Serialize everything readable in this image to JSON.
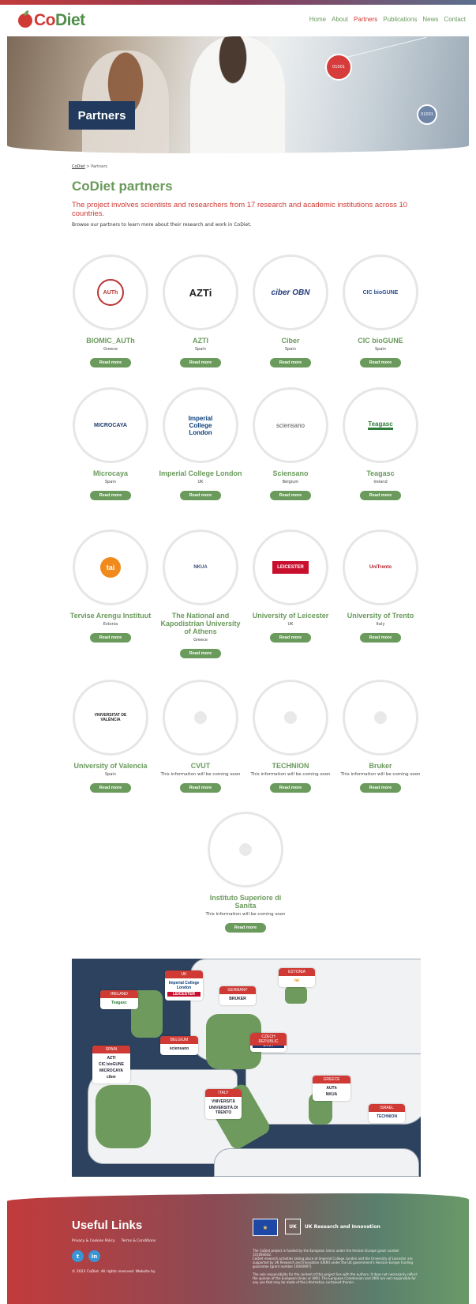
{
  "brand": {
    "name_part1": "Co",
    "name_part2": "Diet"
  },
  "nav": {
    "items": [
      "Home",
      "About",
      "Partners",
      "Publications",
      "News",
      "Contact"
    ],
    "active": "Partners"
  },
  "hero": {
    "label": "Partners",
    "badge1": "01001",
    "badge2": "01001"
  },
  "breadcrumb": {
    "home": "CoDiet",
    "sep": ">",
    "current": "Partners"
  },
  "page": {
    "title": "CoDiet partners",
    "lead": "The project involves scientists and researchers from 17 research and academic institutions across 10 countries.",
    "sub": "Browse our partners to learn more about their research and work in CoDiet."
  },
  "read_more": "Read more",
  "partners": [
    {
      "name": "BIOMIC_AUTh",
      "country": "Greece",
      "logo": "AUTh"
    },
    {
      "name": "AZTI",
      "country": "Spain",
      "logo": "AZTi"
    },
    {
      "name": "Ciber",
      "country": "Spain",
      "logo": "ciber OBN"
    },
    {
      "name": "CIC bioGUNE",
      "country": "Spain",
      "logo": "CIC bioGUNE"
    },
    {
      "name": "Microcaya",
      "country": "Spain",
      "logo": "MICROCAYA"
    },
    {
      "name": "Imperial College London",
      "country": "UK",
      "logo": "Imperial College London"
    },
    {
      "name": "Sciensano",
      "country": "Belgium",
      "logo": "sciensano"
    },
    {
      "name": "Teagasc",
      "country": "Ireland",
      "logo": "Teagasc"
    },
    {
      "name": "Tervise Arengu Instituut",
      "country": "Estonia",
      "logo": "tai"
    },
    {
      "name": "The National and Kapodistrian University of Athens",
      "country": "Greece",
      "logo": "NKUA"
    },
    {
      "name": "University of Leicester",
      "country": "UK",
      "logo": "LEICESTER"
    },
    {
      "name": "University of Trento",
      "country": "Italy",
      "logo": "UniTrento"
    },
    {
      "name": "University of Valencia",
      "country": "Spain",
      "logo": "VNIVERSITAT DE VALÈNCIA"
    },
    {
      "name": "CVUT",
      "country": "This information will be coming soon",
      "logo": ""
    },
    {
      "name": "TECHNION",
      "country": "This information will be coming soon",
      "logo": ""
    },
    {
      "name": "Bruker",
      "country": "This information will be coming soon",
      "logo": ""
    },
    {
      "name": "Instituto Superiore di Sanita",
      "country": "This information will be coming soon",
      "logo": ""
    }
  ],
  "map": {
    "tags": [
      {
        "country": "IRELAND",
        "logos": [
          "Teagasc"
        ]
      },
      {
        "country": "UK",
        "logos": [
          "Imperial College London",
          "LEICESTER"
        ]
      },
      {
        "country": "GERMANY",
        "logos": [
          "BRUKER"
        ]
      },
      {
        "country": "ESTONIA",
        "logos": [
          "tai"
        ]
      },
      {
        "country": "BELGIUM",
        "logos": [
          "sciensano"
        ]
      },
      {
        "country": "CZECH REPUBLIC",
        "logos": [
          "CVUT"
        ]
      },
      {
        "country": "SPAIN",
        "logos": [
          "AZTI",
          "CIC bioGUNE",
          "MICROCAYA",
          "ciber"
        ]
      },
      {
        "country": "ITALY",
        "logos": [
          "VNIVERSITÀ",
          "UNIVERSITÀ DI TRENTO"
        ]
      },
      {
        "country": "GREECE",
        "logos": [
          "AUTh",
          "NKUA"
        ]
      },
      {
        "country": "ISRAEL",
        "logos": [
          "TECHNION"
        ]
      }
    ]
  },
  "footer": {
    "title": "Useful Links",
    "links": [
      "Privacy & Cookies Policy",
      "Terms & Conditions"
    ],
    "social": [
      "twitter",
      "linkedin"
    ],
    "copyright": "© 2023 CoDiet. All rights reserved. Website by",
    "ukri": "UK Research and Innovation",
    "funding": "The CoDiet project is funded by the European Union under the Horizon Europe grant number 101084642.",
    "funding2": "CoDiet research activities taking place at Imperial College London and the University of Leicester are supported by UK Research and Innovation (UKRI) under the UK government's Horizon Europe funding guarantee [grant number 10040907].",
    "disclaimer": "The sole responsibility for the content of this project lies with the authors. It does not necessarily reflect the opinion of the European Union or UKRI. The European Commission and UKRI are not responsible for any use that may be made of the information contained therein."
  }
}
